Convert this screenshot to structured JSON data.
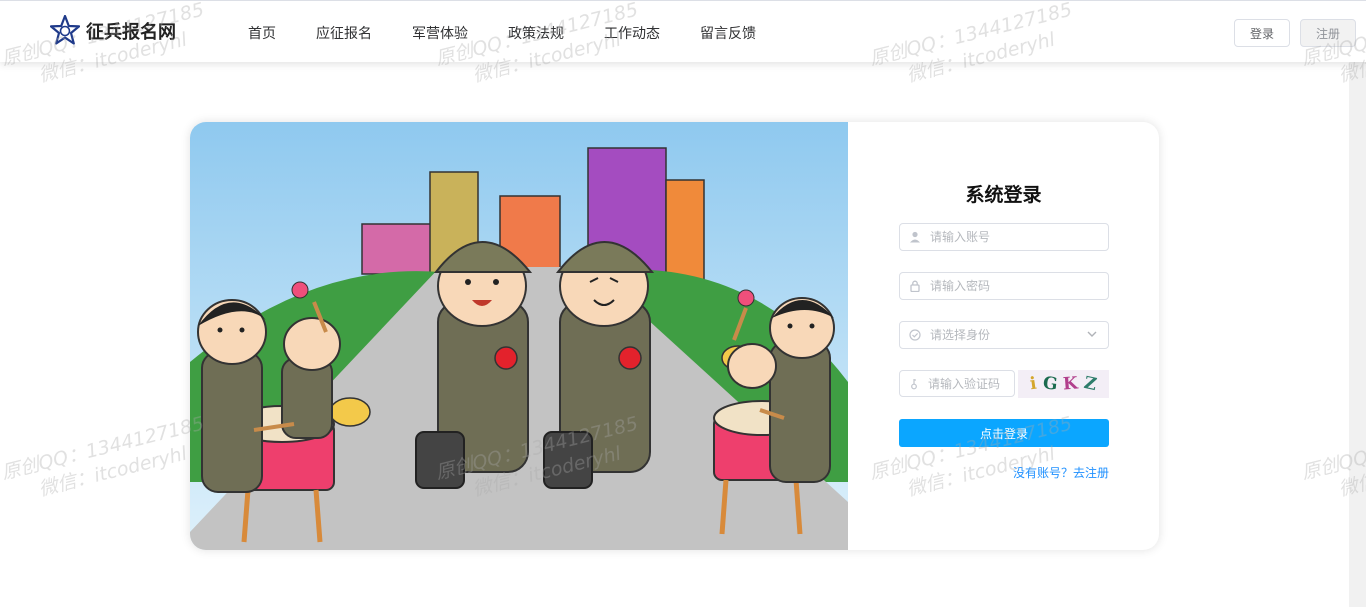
{
  "header": {
    "logo_text": "征兵报名网",
    "nav": [
      "首页",
      "应征报名",
      "军营体验",
      "政策法规",
      "工作动态",
      "留言反馈"
    ],
    "login_button": "登录",
    "register_button": "注册"
  },
  "login_form": {
    "title": "系统登录",
    "account_placeholder": "请输入账号",
    "password_placeholder": "请输入密码",
    "role_placeholder": "请选择身份",
    "captcha_placeholder": "请输入验证码",
    "captcha_chars": [
      "i",
      "G",
      "K",
      "Z"
    ],
    "submit_label": "点击登录",
    "register_link": "没有账号？去注册"
  },
  "watermark": {
    "line1": "原创QQ：1344127185",
    "line2": "微信：itcoderyhl"
  },
  "icons": {
    "logo": "star-badge-icon",
    "account": "user-icon",
    "password": "lock-icon",
    "role": "check-circle-icon",
    "captcha": "key-icon",
    "select": "chevron-down-icon"
  },
  "colors": {
    "primary_button": "#0ba6ff",
    "link": "#1e90ff"
  }
}
